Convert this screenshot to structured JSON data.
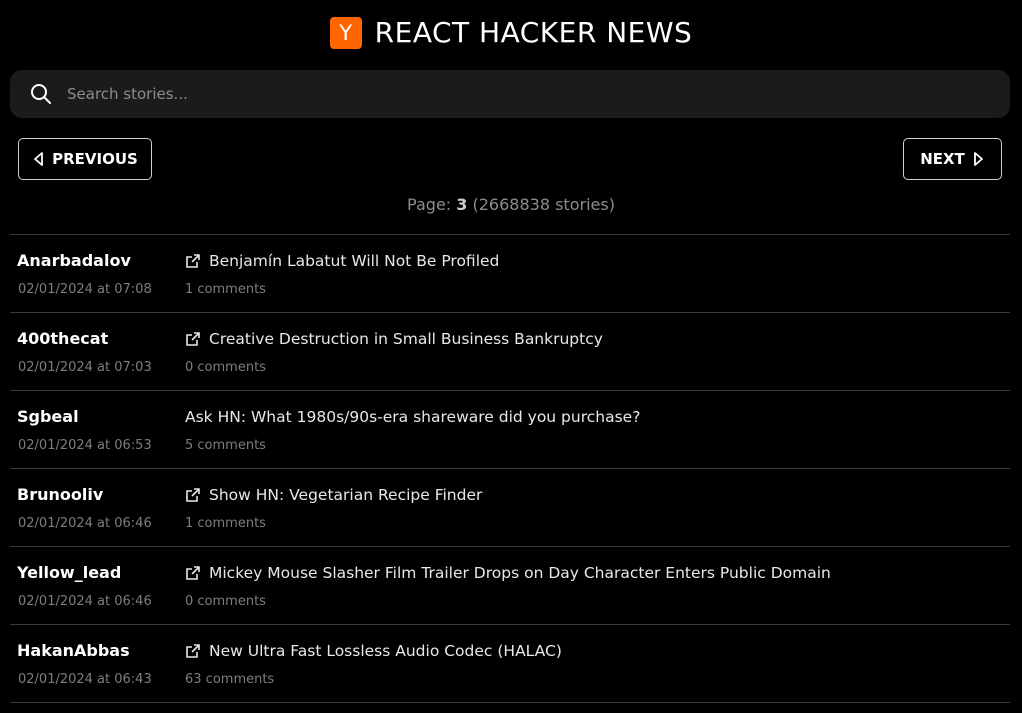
{
  "header": {
    "logo_letter": "Y",
    "title": "REACT HACKER NEWS",
    "brand_color": "#ff6600"
  },
  "search": {
    "placeholder": "Search stories...",
    "value": ""
  },
  "pagination": {
    "prev_label": "PREVIOUS",
    "next_label": "NEXT",
    "page_prefix": "Page: ",
    "page_number": "3",
    "stories_count": "(2668838 stories)"
  },
  "stories": [
    {
      "author": "Anarbadalov",
      "timestamp": "02/01/2024 at 07:08",
      "title": "Benjamín Labatut Will Not Be Profiled",
      "has_link": true,
      "comments": "1 comments"
    },
    {
      "author": "400thecat",
      "timestamp": "02/01/2024 at 07:03",
      "title": "Creative Destruction in Small Business Bankruptcy",
      "has_link": true,
      "comments": "0 comments"
    },
    {
      "author": "Sgbeal",
      "timestamp": "02/01/2024 at 06:53",
      "title": "Ask HN: What 1980s/90s-era shareware did you purchase?",
      "has_link": false,
      "comments": "5 comments"
    },
    {
      "author": "Brunooliv",
      "timestamp": "02/01/2024 at 06:46",
      "title": "Show HN: Vegetarian Recipe Finder",
      "has_link": true,
      "comments": "1 comments"
    },
    {
      "author": "Yellow_lead",
      "timestamp": "02/01/2024 at 06:46",
      "title": "Mickey Mouse Slasher Film Trailer Drops on Day Character Enters Public Domain",
      "has_link": true,
      "comments": "0 comments"
    },
    {
      "author": "HakanAbbas",
      "timestamp": "02/01/2024 at 06:43",
      "title": "New Ultra Fast Lossless Audio Codec (HALAC)",
      "has_link": true,
      "comments": "63 comments"
    }
  ]
}
